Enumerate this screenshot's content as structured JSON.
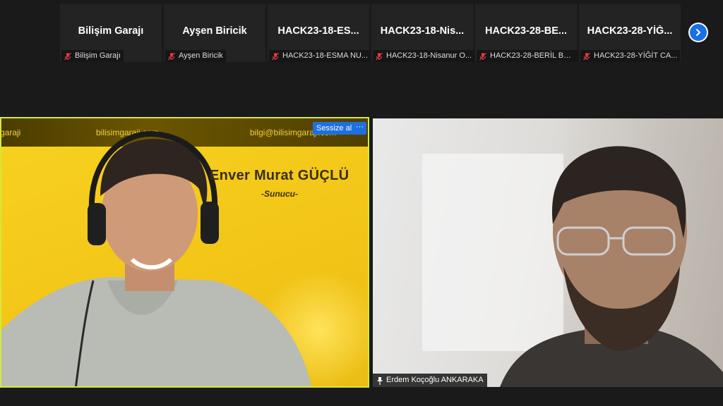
{
  "participants": [
    {
      "display": "Bilişim Garajı",
      "label": "Bilişim Garajı"
    },
    {
      "display": "Ayşen Biricik",
      "label": "Ayşen Biricik"
    },
    {
      "display": "HACK23-18-ES...",
      "label": "HACK23-18-ESMA NU..."
    },
    {
      "display": "HACK23-18-Nis...",
      "label": "HACK23-18-Nisanur O..."
    },
    {
      "display": "HACK23-28-BE...",
      "label": "HACK23-28-BERİL BER..."
    },
    {
      "display": "HACK23-28-YİĞ...",
      "label": "HACK23-28-YİĞİT CA..."
    }
  ],
  "speaker": {
    "banner_left": "garaji",
    "banner_center": "bilisimgaraji.com",
    "banner_right": "bilgi@bilisimgaraji.com",
    "name": "Enver Murat GÜÇLÜ",
    "role": "-Sunucu-",
    "mute_label": "Sessize al",
    "more_label": "···"
  },
  "second_video": {
    "name_tag": "Erdem Koçoğlu ANKARAKA"
  },
  "colors": {
    "active_border": "#d6e83a",
    "button_blue": "#1f6fde",
    "mic_red": "#e0393e"
  },
  "icons": {
    "mic_off": "mic-off-icon",
    "next": "chevron-right-icon",
    "pin": "pin-icon"
  }
}
